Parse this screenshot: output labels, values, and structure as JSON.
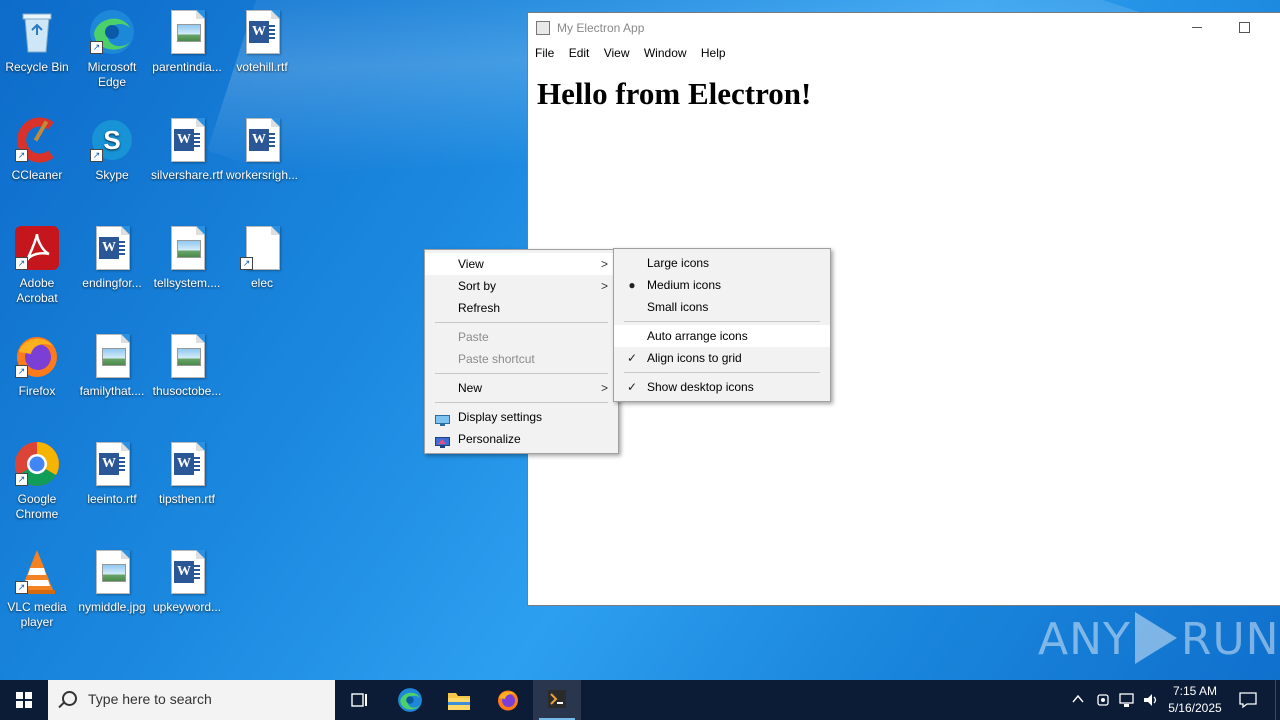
{
  "desktop": {
    "icons": [
      {
        "label": "Recycle Bin",
        "icon": "recycle-bin-icon"
      },
      {
        "label": "Microsoft Edge",
        "icon": "edge-icon"
      },
      {
        "label": "parentindia...",
        "icon": "image-file-icon"
      },
      {
        "label": "votehill.rtf",
        "icon": "word-document-icon"
      },
      {
        "label": "CCleaner",
        "icon": "ccleaner-icon"
      },
      {
        "label": "Skype",
        "icon": "skype-icon"
      },
      {
        "label": "silvershare.rtf",
        "icon": "word-document-icon"
      },
      {
        "label": "workersrigh...",
        "icon": "word-document-icon"
      },
      {
        "label": "Adobe Acrobat",
        "icon": "acrobat-icon"
      },
      {
        "label": "endingfor...",
        "icon": "word-document-icon"
      },
      {
        "label": "tellsystem....",
        "icon": "image-file-icon"
      },
      {
        "label": "elec",
        "icon": "blank-file-icon"
      },
      {
        "label": "Firefox",
        "icon": "firefox-icon"
      },
      {
        "label": "familythat....",
        "icon": "image-file-icon"
      },
      {
        "label": "thusoctobe...",
        "icon": "image-file-icon"
      },
      {
        "label": "Google Chrome",
        "icon": "chrome-icon"
      },
      {
        "label": "leeinto.rtf",
        "icon": "word-document-icon"
      },
      {
        "label": "tipsthen.rtf",
        "icon": "word-document-icon"
      },
      {
        "label": "VLC media player",
        "icon": "vlc-icon"
      },
      {
        "label": "nymiddle.jpg",
        "icon": "image-file-icon"
      },
      {
        "label": "upkeyword...",
        "icon": "word-document-icon"
      }
    ]
  },
  "app_window": {
    "title": "My Electron App",
    "menu": [
      "File",
      "Edit",
      "View",
      "Window",
      "Help"
    ],
    "heading": "Hello from Electron!"
  },
  "context_menu": {
    "view": "View",
    "sort_by": "Sort by",
    "refresh": "Refresh",
    "paste": "Paste",
    "paste_shortcut": "Paste shortcut",
    "new": "New",
    "display_settings": "Display settings",
    "personalize": "Personalize"
  },
  "view_submenu": {
    "large_icons": "Large icons",
    "medium_icons": "Medium icons",
    "small_icons": "Small icons",
    "auto_arrange": "Auto arrange icons",
    "align_to_grid": "Align icons to grid",
    "show_desktop_icons": "Show desktop icons",
    "selected_size": "Medium icons",
    "align_to_grid_checked": true,
    "show_desktop_icons_checked": true,
    "auto_arrange_checked": false
  },
  "watermark": {
    "left": "ANY",
    "right": "RUN"
  },
  "taskbar": {
    "search_placeholder": "Type here to search",
    "time": "7:15 AM",
    "date": "5/16/2025"
  }
}
